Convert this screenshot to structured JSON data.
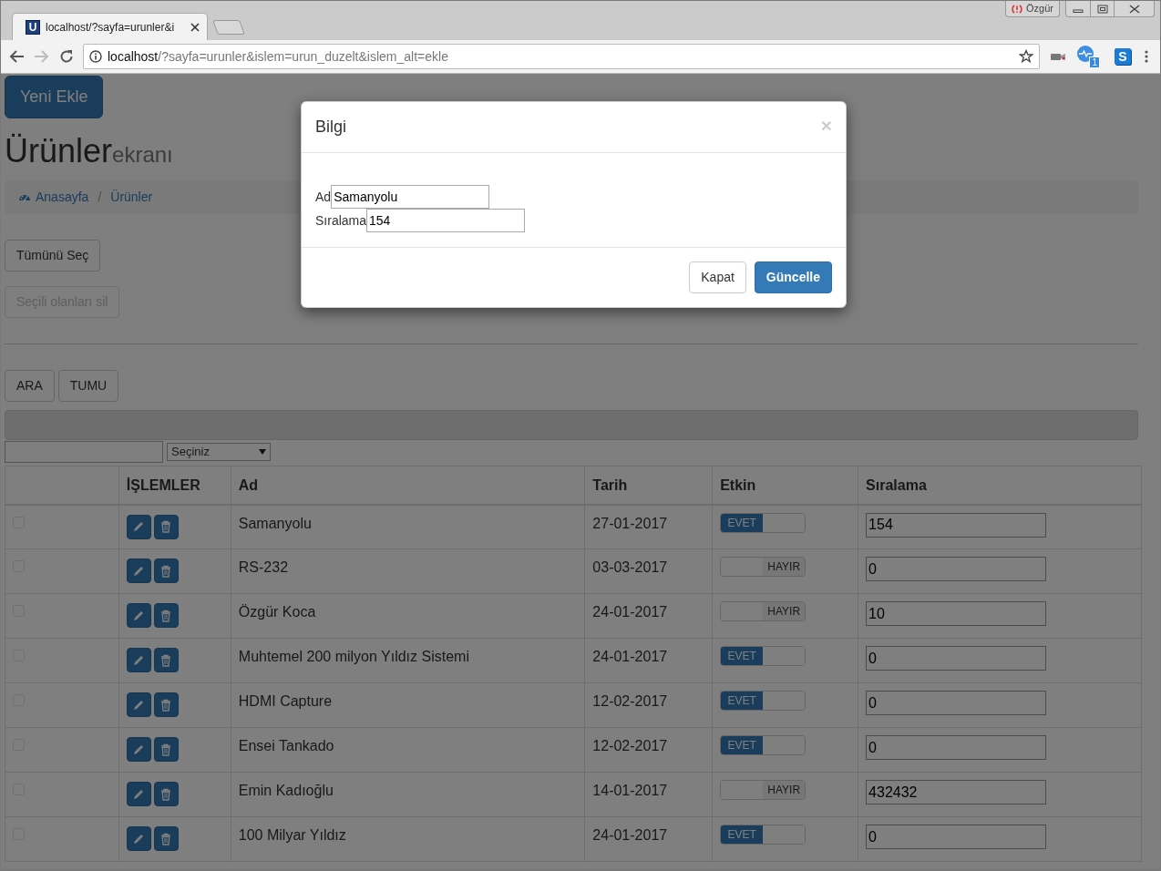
{
  "browser": {
    "tab_title": "localhost/?sayfa=urunler&i",
    "favicon_letter": "U",
    "profile": "Özgür",
    "address_host": "localhost",
    "address_path": "/?sayfa=urunler&islem=urun_duzelt&islem_alt=ekle",
    "extension_badge": "1",
    "extension_letter": "S"
  },
  "page": {
    "new_button": "Yeni Ekle",
    "title": "Ürünler",
    "subtitle": "ekranı",
    "breadcrumb_separator": "/",
    "breadcrumb": [
      {
        "label": "Anasayfa",
        "kind": "home"
      },
      {
        "label": "Ürünler",
        "kind": "link"
      }
    ],
    "select_all": {
      "label": "Tümünü Seç",
      "disabled": false
    },
    "delete_selected": {
      "label": "Seçili olanları sil",
      "disabled": true
    },
    "search_buttons": [
      "ARA",
      "TUMU"
    ],
    "filter_select": "Seçiniz",
    "table": {
      "columns": [
        "İŞLEMLER",
        "Ad",
        "Tarih",
        "Etkin",
        "Sıralama"
      ],
      "rows": [
        {
          "checked": false,
          "name": "Samanyolu",
          "date": "27-01-2017",
          "active": true,
          "status": "EVET",
          "order": "154"
        },
        {
          "checked": false,
          "name": "RS-232",
          "date": "03-03-2017",
          "active": false,
          "status": "HAYIR",
          "order": "0"
        },
        {
          "checked": false,
          "name": "Özgür Koca",
          "date": "24-01-2017",
          "active": false,
          "status": "HAYIR",
          "order": "10"
        },
        {
          "checked": false,
          "name": "Muhtemel 200 milyon Yıldız Sistemi",
          "date": "24-01-2017",
          "active": true,
          "status": "EVET",
          "order": "0"
        },
        {
          "checked": false,
          "name": "HDMI Capture",
          "date": "12-02-2017",
          "active": true,
          "status": "EVET",
          "order": "0"
        },
        {
          "checked": false,
          "name": "Ensei Tankado",
          "date": "12-02-2017",
          "active": true,
          "status": "EVET",
          "order": "0"
        },
        {
          "checked": false,
          "name": "Emin Kadıoğlu",
          "date": "14-01-2017",
          "active": false,
          "status": "HAYIR",
          "order": "432432"
        },
        {
          "checked": false,
          "name": "100 Milyar Yıldız",
          "date": "24-01-2017",
          "active": true,
          "status": "EVET",
          "order": "0"
        }
      ]
    }
  },
  "modal": {
    "title": "Bilgi",
    "close": "×",
    "fields": [
      {
        "label": "Ad",
        "value": "Samanyolu"
      },
      {
        "label": "Sıralama",
        "value": "154"
      }
    ],
    "buttons": [
      {
        "label": "Kapat",
        "kind": "default"
      },
      {
        "label": "Güncelle",
        "kind": "primary"
      }
    ]
  }
}
